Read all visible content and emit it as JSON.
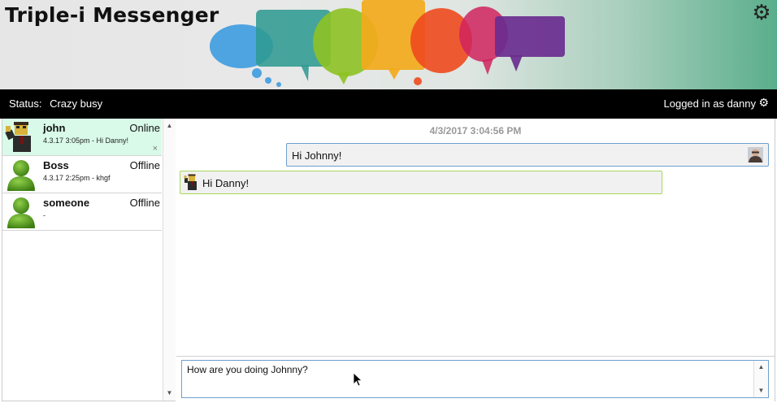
{
  "app": {
    "title": "Triple-i Messenger",
    "gear_icon": "gear-icon"
  },
  "status_bar": {
    "status_label": "Status:",
    "status_value": "Crazy busy",
    "logged_in_text": "Logged in as danny",
    "gear_icon": "gear-icon"
  },
  "contacts": [
    {
      "name": "john",
      "state": "Online",
      "last_message": "4.3.17 3:05pm - Hi Danny!",
      "active": true,
      "close": "×"
    },
    {
      "name": "Boss",
      "state": "Offline",
      "last_message": "4.3.17 2:25pm - khgf",
      "active": false
    },
    {
      "name": "someone",
      "state": "Offline",
      "last_message": "-",
      "active": false
    }
  ],
  "chat": {
    "date": "4/3/2017 3:04:56 PM",
    "messages": [
      {
        "direction": "out",
        "text": "Hi Johnny!"
      },
      {
        "direction": "in",
        "text": "Hi Danny!"
      }
    ],
    "input_value": "How are you doing Johnny?"
  },
  "colors": {
    "active_contact_bg": "#d9fae9",
    "outgoing_border": "#6e9fd0",
    "incoming_border": "#a8d85a",
    "status_bar_bg": "#000000"
  }
}
